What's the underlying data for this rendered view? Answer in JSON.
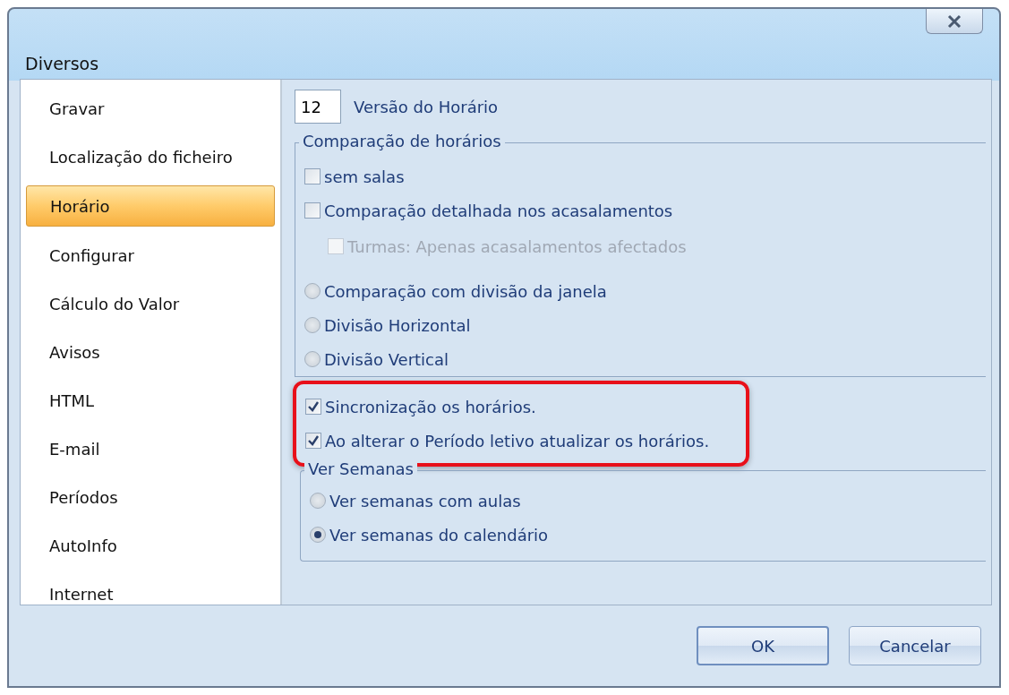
{
  "window": {
    "title": "Diversos"
  },
  "sidebar": {
    "items": [
      {
        "label": "Gravar",
        "selected": false
      },
      {
        "label": "Localização do ficheiro",
        "selected": false
      },
      {
        "label": "Horário",
        "selected": true
      },
      {
        "label": "Configurar",
        "selected": false
      },
      {
        "label": "Cálculo do Valor",
        "selected": false
      },
      {
        "label": "Avisos",
        "selected": false
      },
      {
        "label": "HTML",
        "selected": false
      },
      {
        "label": "E-mail",
        "selected": false
      },
      {
        "label": "Períodos",
        "selected": false
      },
      {
        "label": "AutoInfo",
        "selected": false
      },
      {
        "label": "Internet",
        "selected": false
      }
    ]
  },
  "version": {
    "value": "12",
    "label": "Versão do Horário"
  },
  "comparison": {
    "legend": "Comparação de horários",
    "options": [
      {
        "kind": "checkbox",
        "label": "sem salas",
        "checked": false,
        "disabled": false
      },
      {
        "kind": "checkbox",
        "label": "Comparação detalhada nos acasalamentos",
        "checked": false,
        "disabled": false,
        "children": [
          {
            "kind": "checkbox",
            "label": "Turmas: Apenas acasalamentos afectados",
            "checked": false,
            "disabled": true
          }
        ]
      },
      {
        "kind": "radio",
        "label": "Comparação com divisão da janela",
        "selected": false,
        "disabled": false
      },
      {
        "kind": "radio",
        "label": "Divisão Horizontal",
        "selected": false,
        "disabled": false
      },
      {
        "kind": "radio",
        "label": "Divisão Vertical",
        "selected": false,
        "disabled": false
      }
    ]
  },
  "sync": {
    "highlighted": true,
    "options": [
      {
        "label": "Sincronização os horários.",
        "checked": true
      },
      {
        "label": "Ao alterar o Período letivo atualizar os horários.",
        "checked": true
      }
    ]
  },
  "weeks": {
    "legend": "Ver Semanas",
    "options": [
      {
        "label": "Ver semanas com aulas",
        "selected": false
      },
      {
        "label": "Ver semanas do calendário",
        "selected": true
      }
    ]
  },
  "buttons": [
    {
      "label": "OK",
      "default": true
    },
    {
      "label": "Cancelar",
      "default": false
    }
  ]
}
